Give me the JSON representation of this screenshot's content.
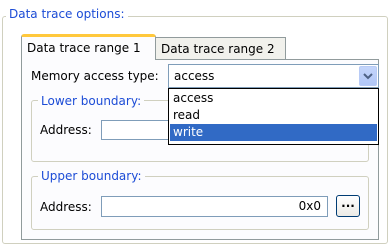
{
  "group_title": "Data trace options:",
  "tabs": [
    {
      "label": "Data trace range 1",
      "active": true
    },
    {
      "label": "Data trace range 2",
      "active": false
    }
  ],
  "memory_access": {
    "label": "Memory access type:",
    "value": "access",
    "options": [
      "access",
      "read",
      "write"
    ],
    "highlighted": "write"
  },
  "lower": {
    "title": "Lower boundary:",
    "address_label": "Address:",
    "address_value": "",
    "browse_label": "..."
  },
  "upper": {
    "title": "Upper boundary:",
    "address_label": "Address:",
    "address_value": "0x0",
    "browse_label": "..."
  },
  "colors": {
    "legend_blue": "#1c4cd6",
    "selection": "#316ac5",
    "tab_highlight": "#ffc83c"
  },
  "icons": {
    "dropdown": "chevron-down-icon"
  }
}
